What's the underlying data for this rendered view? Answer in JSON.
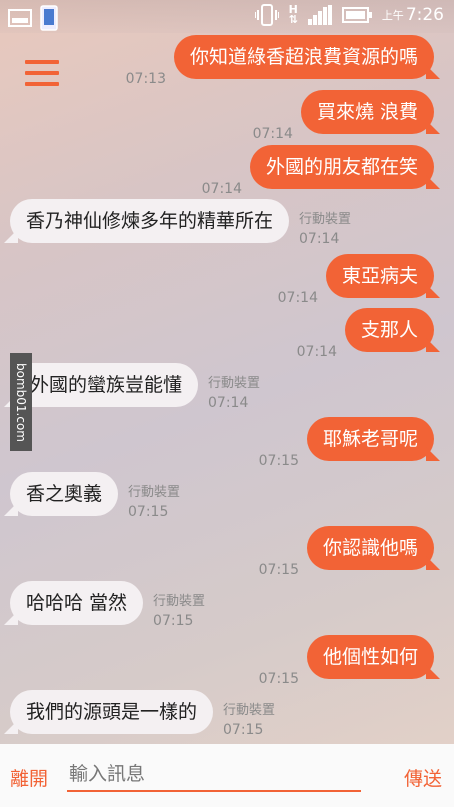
{
  "status_bar": {
    "clock": "7:26",
    "ampm": "上午",
    "network": "H"
  },
  "messages": [
    {
      "side": "me",
      "text": "你知道綠香超浪費資源的嗎",
      "time": "07:13"
    },
    {
      "side": "me",
      "text": "買來燒 浪費",
      "time": "07:14"
    },
    {
      "side": "me",
      "text": "外國的朋友都在笑",
      "time": "07:14"
    },
    {
      "side": "them",
      "text": "香乃神仙修煉多年的精華所在",
      "device": "行動裝置",
      "time": "07:14"
    },
    {
      "side": "me",
      "text": "東亞病夫",
      "time": "07:14"
    },
    {
      "side": "me",
      "text": "支那人",
      "time": "07:14"
    },
    {
      "side": "them",
      "text": "外國的蠻族豈能懂",
      "device": "行動裝置",
      "time": "07:14"
    },
    {
      "side": "me",
      "text": "耶穌老哥呢",
      "time": "07:15"
    },
    {
      "side": "them",
      "text": "香之奧義",
      "device": "行動裝置",
      "time": "07:15"
    },
    {
      "side": "me",
      "text": "你認識他嗎",
      "time": "07:15"
    },
    {
      "side": "them",
      "text": "哈哈哈 當然",
      "device": "行動裝置",
      "time": "07:15"
    },
    {
      "side": "me",
      "text": "他個性如何",
      "time": "07:15"
    },
    {
      "side": "them",
      "text": "我們的源頭是一樣的",
      "device": "行動裝置",
      "time": "07:15"
    }
  ],
  "watermark": "bomb01.com",
  "bottom_bar": {
    "leave_label": "離開",
    "input_placeholder": "輸入訊息",
    "send_label": "傳送"
  },
  "colors": {
    "accent": "#f26336",
    "incoming_bubble": "#f4f0f2"
  }
}
